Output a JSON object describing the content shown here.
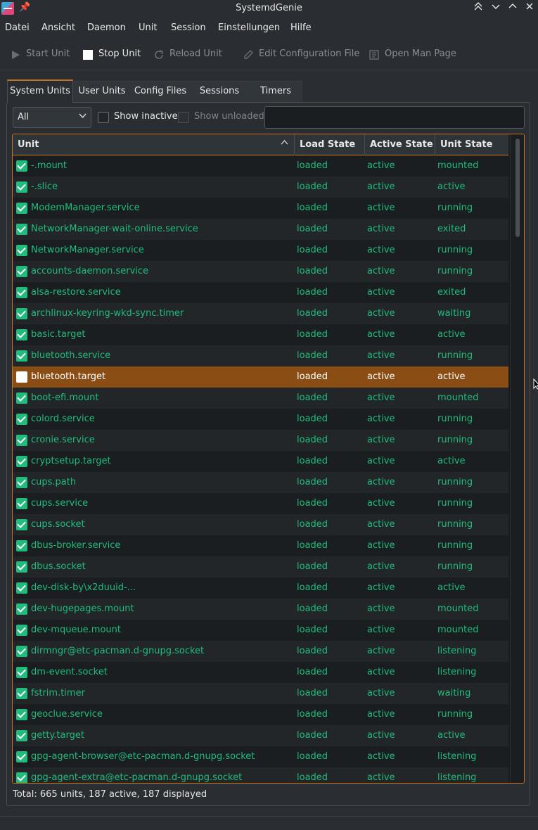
{
  "window": {
    "title": "SystemdGenie"
  },
  "menu": [
    "Datei",
    "Ansicht",
    "Daemon",
    "Unit",
    "Session",
    "Einstellungen",
    "Hilfe"
  ],
  "toolbar": {
    "start": "Start Unit",
    "stop": "Stop Unit",
    "reload": "Reload Unit",
    "edit": "Edit Configuration File",
    "man": "Open Man Page"
  },
  "tabs": [
    "System Units",
    "User Units",
    "Config Files",
    "Sessions",
    "Timers"
  ],
  "filter": {
    "selected": "All",
    "show_inactive": "Show inactive",
    "show_unloaded": "Show unloaded",
    "search_value": ""
  },
  "table": {
    "headers": [
      "Unit",
      "Load State",
      "Active State",
      "Unit State"
    ],
    "rows": [
      {
        "unit": "-.mount",
        "load": "loaded",
        "active": "active",
        "state": "mounted"
      },
      {
        "unit": "-.slice",
        "load": "loaded",
        "active": "active",
        "state": "active"
      },
      {
        "unit": "ModemManager.service",
        "load": "loaded",
        "active": "active",
        "state": "running"
      },
      {
        "unit": "NetworkManager-wait-online.service",
        "load": "loaded",
        "active": "active",
        "state": "exited"
      },
      {
        "unit": "NetworkManager.service",
        "load": "loaded",
        "active": "active",
        "state": "running"
      },
      {
        "unit": "accounts-daemon.service",
        "load": "loaded",
        "active": "active",
        "state": "running"
      },
      {
        "unit": "alsa-restore.service",
        "load": "loaded",
        "active": "active",
        "state": "exited"
      },
      {
        "unit": "archlinux-keyring-wkd-sync.timer",
        "load": "loaded",
        "active": "active",
        "state": "waiting"
      },
      {
        "unit": "basic.target",
        "load": "loaded",
        "active": "active",
        "state": "active"
      },
      {
        "unit": "bluetooth.service",
        "load": "loaded",
        "active": "active",
        "state": "running"
      },
      {
        "unit": "bluetooth.target",
        "load": "loaded",
        "active": "active",
        "state": "active",
        "selected": true
      },
      {
        "unit": "boot-efi.mount",
        "load": "loaded",
        "active": "active",
        "state": "mounted"
      },
      {
        "unit": "colord.service",
        "load": "loaded",
        "active": "active",
        "state": "running"
      },
      {
        "unit": "cronie.service",
        "load": "loaded",
        "active": "active",
        "state": "running"
      },
      {
        "unit": "cryptsetup.target",
        "load": "loaded",
        "active": "active",
        "state": "active"
      },
      {
        "unit": "cups.path",
        "load": "loaded",
        "active": "active",
        "state": "running"
      },
      {
        "unit": "cups.service",
        "load": "loaded",
        "active": "active",
        "state": "running"
      },
      {
        "unit": "cups.socket",
        "load": "loaded",
        "active": "active",
        "state": "running"
      },
      {
        "unit": "dbus-broker.service",
        "load": "loaded",
        "active": "active",
        "state": "running"
      },
      {
        "unit": "dbus.socket",
        "load": "loaded",
        "active": "active",
        "state": "running"
      },
      {
        "unit": "dev-disk-by\\x2duuid-...",
        "load": "loaded",
        "active": "active",
        "state": "active"
      },
      {
        "unit": "dev-hugepages.mount",
        "load": "loaded",
        "active": "active",
        "state": "mounted"
      },
      {
        "unit": "dev-mqueue.mount",
        "load": "loaded",
        "active": "active",
        "state": "mounted"
      },
      {
        "unit": "dirmngr@etc-pacman.d-gnupg.socket",
        "load": "loaded",
        "active": "active",
        "state": "listening"
      },
      {
        "unit": "dm-event.socket",
        "load": "loaded",
        "active": "active",
        "state": "listening"
      },
      {
        "unit": "fstrim.timer",
        "load": "loaded",
        "active": "active",
        "state": "waiting"
      },
      {
        "unit": "geoclue.service",
        "load": "loaded",
        "active": "active",
        "state": "running"
      },
      {
        "unit": "getty.target",
        "load": "loaded",
        "active": "active",
        "state": "active"
      },
      {
        "unit": "gpg-agent-browser@etc-pacman.d-gnupg.socket",
        "load": "loaded",
        "active": "active",
        "state": "listening"
      },
      {
        "unit": "gpg-agent-extra@etc-pacman.d-gnupg.socket",
        "load": "loaded",
        "active": "active",
        "state": "listening"
      }
    ]
  },
  "status": "Total: 665 units, 187 active, 187 displayed",
  "colors": {
    "accent": "#c8741e",
    "selection": "#8a4e15",
    "active_text": "#1fbc7c"
  }
}
